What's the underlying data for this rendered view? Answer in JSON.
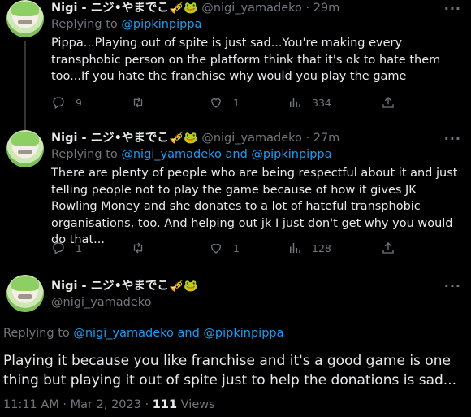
{
  "tweets": [
    {
      "name": "Nigi - ニジ•やまでこ",
      "emoji": "🎺🐸",
      "handle": "@nigi_yamadeko",
      "time": "29m",
      "replying_prefix": "Replying to",
      "replying_to": "@pipkinpippa",
      "text": "Pippa...Playing out of spite is just sad...You're making every transphobic person on the platform think that it's ok to hate them too...If you hate the franchise why would you play the game",
      "replies": "9",
      "retweets": "",
      "likes": "1",
      "views": "334"
    },
    {
      "name": "Nigi - ニジ•やまでこ",
      "emoji": "🎺🐸",
      "handle": "@nigi_yamadeko",
      "time": "27m",
      "replying_prefix": "Replying to",
      "replying_to": "@nigi_yamadeko and @pipkinpippa",
      "text": "There are plenty of people who are being respectful about it and just telling people not to play the game because of how it gives JK Rowling Money and she donates to a lot of hateful transphobic organisations, too. And helping out jk I just don't get why you would do that...",
      "replies": "1",
      "retweets": "",
      "likes": "1",
      "views": "128"
    }
  ],
  "main_tweet": {
    "name": "Nigi - ニジ•やまでこ",
    "emoji": "🎺🐸",
    "handle": "@nigi_yamadeko",
    "replying_prefix": "Replying to",
    "replying_to": "@nigi_yamadeko and @pipkinpippa",
    "text": "Playing it because you like franchise and it's a good game is one thing but playing it out of spite just to help the donations is sad...",
    "timestamp": "11:11 AM · Mar 2, 2023 · ",
    "views_count": "111",
    "views_label": " Views"
  },
  "more_label": "···",
  "colors": {
    "background": "#000000",
    "text": "#e7e9ea",
    "muted": "#71767b",
    "link": "#1d9bf0"
  }
}
